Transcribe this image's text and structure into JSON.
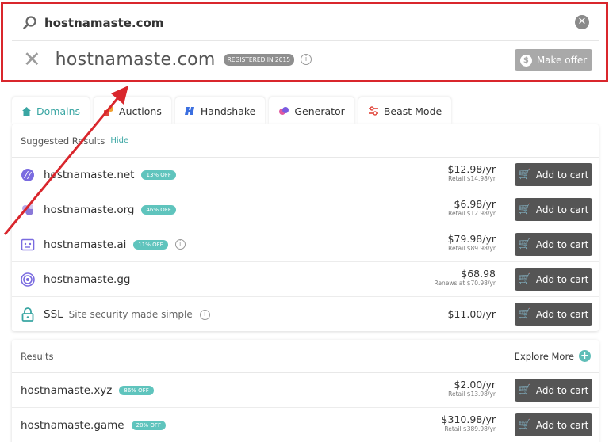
{
  "search": {
    "query": "hostnamaste.com"
  },
  "taken": {
    "domain": "hostnamaste.com",
    "registered_badge": "REGISTERED IN 2015",
    "info": "i",
    "make_offer_label": "Make offer",
    "offer_coin": "$"
  },
  "tabs": [
    {
      "label": "Domains",
      "icon": "home-icon"
    },
    {
      "label": "Auctions",
      "icon": "auction-icon"
    },
    {
      "label": "Handshake",
      "icon": "handshake-icon"
    },
    {
      "label": "Generator",
      "icon": "generator-icon"
    },
    {
      "label": "Beast Mode",
      "icon": "beast-mode-icon"
    }
  ],
  "suggested": {
    "header": "Suggested Results",
    "hide_label": "Hide",
    "rows": [
      {
        "domain": "hostnamaste.net",
        "badge": "13% OFF",
        "price": "$12.98/yr",
        "retail": "Retail $14.98/yr",
        "button": "Add to cart"
      },
      {
        "domain": "hostnamaste.org",
        "badge": "46% OFF",
        "price": "$6.98/yr",
        "retail": "Retail $12.98/yr",
        "button": "Add to cart"
      },
      {
        "domain": "hostnamaste.ai",
        "badge": "11% OFF",
        "price": "$79.98/yr",
        "retail": "Retail $89.98/yr",
        "button": "Add to cart"
      },
      {
        "domain": "hostnamaste.gg",
        "price": "$68.98",
        "retail": "Renews at $70.98/yr",
        "button": "Add to cart"
      },
      {
        "domain": "SSL",
        "subtitle": "Site security made simple",
        "price": "$11.00/yr",
        "button": "Add to cart"
      }
    ]
  },
  "results": {
    "header": "Results",
    "explore_label": "Explore More",
    "rows": [
      {
        "domain": "hostnamaste.xyz",
        "badge": "86% OFF",
        "price": "$2.00/yr",
        "retail": "Retail $13.98/yr",
        "button": "Add to cart"
      },
      {
        "domain": "hostnamaste.game",
        "badge": "20% OFF",
        "price": "$310.98/yr",
        "retail": "Retail $389.98/yr",
        "button": "Add to cart"
      }
    ]
  },
  "colors": {
    "accent": "#3aa6a3",
    "badge": "#5fc4bd",
    "button": "#555555",
    "highlight": "#d9262c"
  }
}
